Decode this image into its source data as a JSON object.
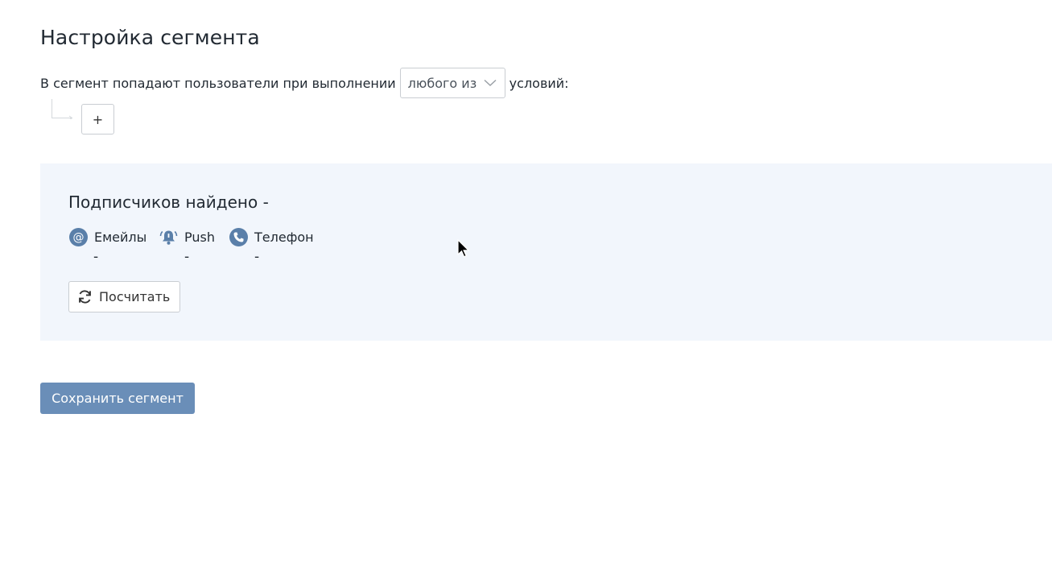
{
  "page": {
    "title": "Настройка сегмента"
  },
  "condition": {
    "prefix": "В сегмент попадают пользователи при выполнении",
    "selected": "любого из",
    "suffix": "условий:",
    "add_label": "+"
  },
  "stats": {
    "title": "Подписчиков найдено -",
    "channels": [
      {
        "label": "Емейлы",
        "icon": "at-icon",
        "count": "-"
      },
      {
        "label": "Push",
        "icon": "bell-icon",
        "count": "-"
      },
      {
        "label": "Телефон",
        "icon": "phone-icon",
        "count": "-"
      }
    ],
    "recalc_label": "Посчитать"
  },
  "actions": {
    "save_label": "Сохранить сегмент"
  },
  "colors": {
    "accent": "#6a8eb8",
    "icon": "#5a7fa9",
    "panel_bg": "#f2f6fc",
    "border": "#c9cdd2"
  }
}
